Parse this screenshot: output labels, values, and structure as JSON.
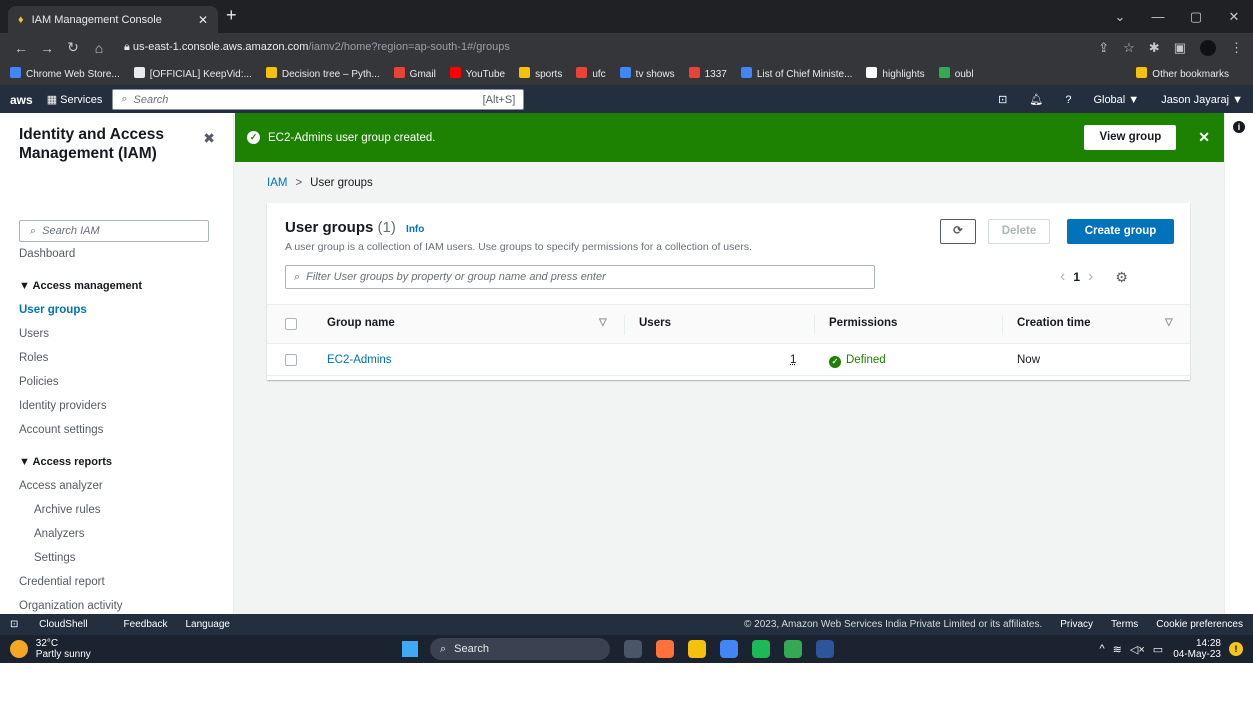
{
  "browser": {
    "tab_title": "IAM Management Console",
    "url_host": "us-east-1.console.aws.amazon.com",
    "url_path": "/iamv2/home?region=ap-south-1#/groups",
    "bookmarks": [
      {
        "label": "Chrome Web Store...",
        "color": "#4285f4"
      },
      {
        "label": "[OFFICIAL] KeepVid:...",
        "color": "#e8eaed"
      },
      {
        "label": "Decision tree – Pyth...",
        "color": "#f4c20d"
      },
      {
        "label": "Gmail",
        "color": "#ea4335"
      },
      {
        "label": "YouTube",
        "color": "#ff0000"
      },
      {
        "label": "sports",
        "color": "#f4c20d"
      },
      {
        "label": "ufc",
        "color": "#ea4335"
      },
      {
        "label": "tv shows",
        "color": "#4285f4"
      },
      {
        "label": "1337",
        "color": "#ea4335"
      },
      {
        "label": "List of Chief Ministe...",
        "color": "#4285f4"
      },
      {
        "label": "highlights",
        "color": "#ffffff"
      },
      {
        "label": "oubl",
        "color": "#34a853"
      }
    ],
    "other_bookmarks": "Other bookmarks"
  },
  "aws_nav": {
    "logo": "aws",
    "services": "Services",
    "search_placeholder": "Search",
    "search_shortcut": "[Alt+S]",
    "region": "Global ▼",
    "user": "Jason Jayaraj ▼"
  },
  "sidebar": {
    "title": "Identity and Access Management (IAM)",
    "search_placeholder": "Search IAM",
    "dashboard": "Dashboard",
    "access_management": "Access management",
    "am_items": [
      "User groups",
      "Users",
      "Roles",
      "Policies",
      "Identity providers",
      "Account settings"
    ],
    "access_reports": "Access reports",
    "ar_items": [
      {
        "label": "Access analyzer",
        "sub": false
      },
      {
        "label": "Archive rules",
        "sub": true
      },
      {
        "label": "Analyzers",
        "sub": true
      },
      {
        "label": "Settings",
        "sub": true
      },
      {
        "label": "Credential report",
        "sub": false
      },
      {
        "label": "Organization activity",
        "sub": false
      }
    ]
  },
  "flash": {
    "message": "EC2-Admins user group created.",
    "view_button": "View group"
  },
  "breadcrumb": {
    "root": "IAM",
    "current": "User groups"
  },
  "panel": {
    "title": "User groups",
    "count": "(1)",
    "info": "Info",
    "description": "A user group is a collection of IAM users. Use groups to specify permissions for a collection of users.",
    "delete": "Delete",
    "create": "Create group",
    "filter_placeholder": "Filter User groups by property or group name and press enter",
    "page": "1",
    "columns": [
      "Group name",
      "Users",
      "Permissions",
      "Creation time"
    ],
    "rows": [
      {
        "group": "EC2-Admins",
        "users": "1",
        "permissions": "Defined",
        "created": "Now"
      }
    ]
  },
  "footer": {
    "left": [
      "CloudShell",
      "Feedback",
      "Language"
    ],
    "copyright": "© 2023, Amazon Web Services India Private Limited or its affiliates.",
    "right": [
      "Privacy",
      "Terms",
      "Cookie preferences"
    ]
  },
  "taskbar": {
    "temp": "32°C",
    "weather": "Partly sunny",
    "search": "Search",
    "time": "14:28",
    "date": "04-May-23",
    "apps": [
      "#4a5568",
      "#ff7139",
      "#f4c20d",
      "#4285f4",
      "#1db954",
      "#34a853",
      "#2b579a"
    ]
  }
}
